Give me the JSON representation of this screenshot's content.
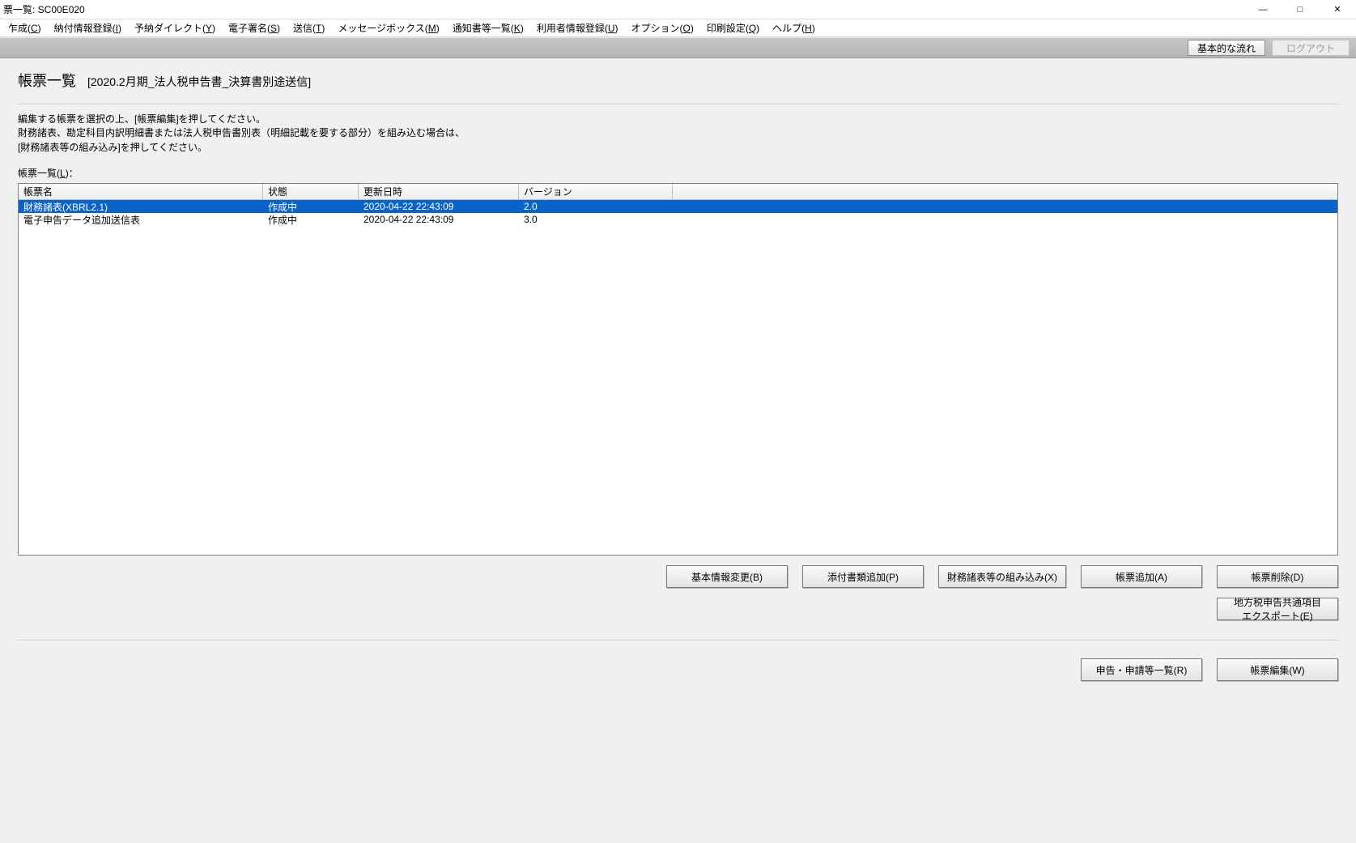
{
  "window": {
    "title": "票一覧: SC00E020"
  },
  "menu": {
    "items": [
      {
        "label": "乍成",
        "accel": "C"
      },
      {
        "label": "納付情報登録",
        "accel": "I"
      },
      {
        "label": "予納ダイレクト",
        "accel": "Y"
      },
      {
        "label": "電子署名",
        "accel": "S"
      },
      {
        "label": "送信",
        "accel": "T"
      },
      {
        "label": "メッセージボックス",
        "accel": "M"
      },
      {
        "label": "通知書等一覧",
        "accel": "K"
      },
      {
        "label": "利用者情報登録",
        "accel": "U"
      },
      {
        "label": "オプション",
        "accel": "O"
      },
      {
        "label": "印刷設定",
        "accel": "Q"
      },
      {
        "label": "ヘルプ",
        "accel": "H"
      }
    ]
  },
  "toolbar": {
    "basic_flow": "基本的な流れ",
    "logout": "ログアウト"
  },
  "page": {
    "title": "帳票一覧",
    "subtitle": "[2020.2月期_法人税申告書_決算書別途送信]",
    "instruction_line1": "編集する帳票を選択の上、[帳票編集]を押してください。",
    "instruction_line2": "財務諸表、勘定科目内訳明細書または法人税申告書別表（明細記載を要する部分）を組み込む場合は、",
    "instruction_line3": "[財務諸表等の組み込み]を押してください。",
    "list_label_pre": "帳票一覧(",
    "list_label_accel": "L",
    "list_label_post": ")："
  },
  "grid": {
    "headers": [
      "帳票名",
      "状態",
      "更新日時",
      "バージョン"
    ],
    "rows": [
      {
        "name": "財務諸表(XBRL2.1)",
        "status": "作成中",
        "updated": "2020-04-22 22:43:09",
        "version": "2.0",
        "selected": true
      },
      {
        "name": "電子申告データ追加送信表",
        "status": "作成中",
        "updated": "2020-04-22 22:43:09",
        "version": "3.0",
        "selected": false
      }
    ]
  },
  "buttons": {
    "row1": [
      {
        "id": "basic-info-change",
        "label": "基本情報変更(B)"
      },
      {
        "id": "attach-add",
        "label": "添付書類追加(P)"
      },
      {
        "id": "fs-import",
        "label": "財務諸表等の組み込み(X)"
      },
      {
        "id": "form-add",
        "label": "帳票追加(A)"
      },
      {
        "id": "form-delete",
        "label": "帳票削除(D)"
      }
    ],
    "row2": [
      {
        "id": "local-tax-export",
        "label": "地方税申告共通項目\nエクスポート(E)"
      }
    ],
    "row3": [
      {
        "id": "application-list",
        "label": "申告・申請等一覧(R)"
      },
      {
        "id": "form-edit",
        "label": "帳票編集(W)"
      }
    ]
  }
}
